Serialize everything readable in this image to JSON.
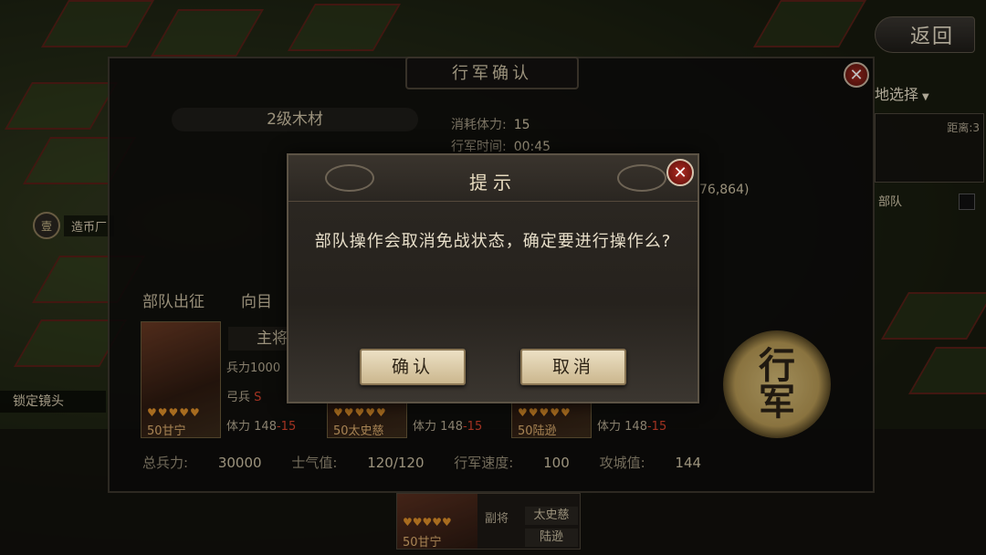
{
  "top_right": {
    "return_label": "返回",
    "land_select_label": "地选择",
    "distance_label": "距离:3",
    "troop_label": "部队"
  },
  "map": {
    "city_name": "造币厂",
    "city_badge": "壹",
    "lock_camera_label": "锁定镜头"
  },
  "march_panel": {
    "title": "行军确认",
    "target": "2级木材",
    "stamina_cost_label": "消耗体力:",
    "stamina_cost_value": "15",
    "march_time_label": "行军时间:",
    "march_time_value": "00:45",
    "coords_partial": "76,864)",
    "tab_dispatch": "部队出征",
    "tab_direction": "向目",
    "main_general_label": "主将",
    "troops_row": "兵力1000",
    "unit_label": "弓兵",
    "unit_rank": "S",
    "generals": [
      {
        "name": "50甘宁",
        "pips": "♥♥♥♥♥",
        "stamina_label": "体力",
        "stamina": "148",
        "cost": "-15"
      },
      {
        "name": "50太史慈",
        "pips": "♥♥♥♥♥",
        "stamina_label": "体力",
        "stamina": "148",
        "cost": "-15"
      },
      {
        "name": "50陆逊",
        "pips": "♥♥♥♥♥",
        "stamina_label": "体力",
        "stamina": "148",
        "cost": "-15"
      }
    ],
    "summary": {
      "total_troops_label": "总兵力:",
      "total_troops": "30000",
      "morale_label": "士气值:",
      "morale": "120/120",
      "speed_label": "行军速度:",
      "speed": "100",
      "siege_label": "攻城值:",
      "siege": "144"
    },
    "march_button": "行军"
  },
  "sub_card": {
    "name": "50甘宁",
    "pips": "♥♥♥♥♥",
    "vice_label": "副将",
    "vice1": "太史慈",
    "vice2": "陆逊"
  },
  "dialog": {
    "title": "提示",
    "message": "部队操作会取消免战状态，确定要进行操作么?",
    "confirm": "确认",
    "cancel": "取消"
  }
}
